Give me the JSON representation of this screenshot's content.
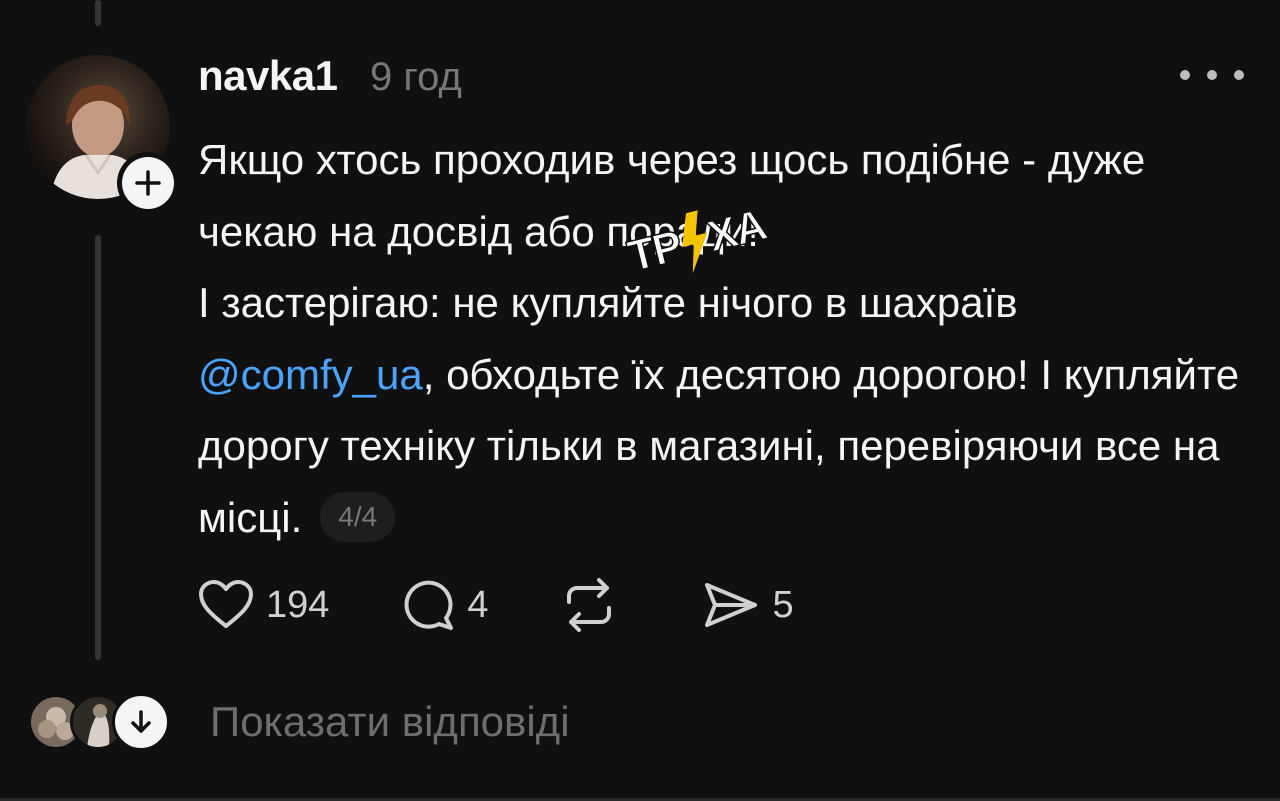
{
  "post": {
    "username": "navka1",
    "timestamp": "9 год",
    "text": {
      "line1": "Якщо хтось проходив через щось подібне - дуже чекаю на досвід або поради!",
      "line2_before": "І застерігаю: не купляйте нічого в шахраїв ",
      "mention": "@comfy_ua",
      "line2_after": ", обходьте їх десятою дорогою! І купляйте дорогу техніку тільки в магазині, перевіряючи все на місці."
    },
    "page_indicator": "4/4",
    "watermark_text": "ТРУХА",
    "actions": {
      "likes": "194",
      "comments": "4",
      "shares": "5"
    }
  },
  "replies": {
    "label": "Показати відповіді"
  },
  "colors": {
    "background": "#101010",
    "text": "#f3f5f7",
    "muted": "#777777",
    "mention": "#4aa3ff",
    "watermark": "#f5c400"
  },
  "icons": {
    "like": "heart-icon",
    "comment": "comment-bubble-icon",
    "repost": "repost-icon",
    "share": "send-icon",
    "more": "more-horizontal-icon",
    "follow": "plus-icon",
    "expand": "arrow-down-icon"
  }
}
